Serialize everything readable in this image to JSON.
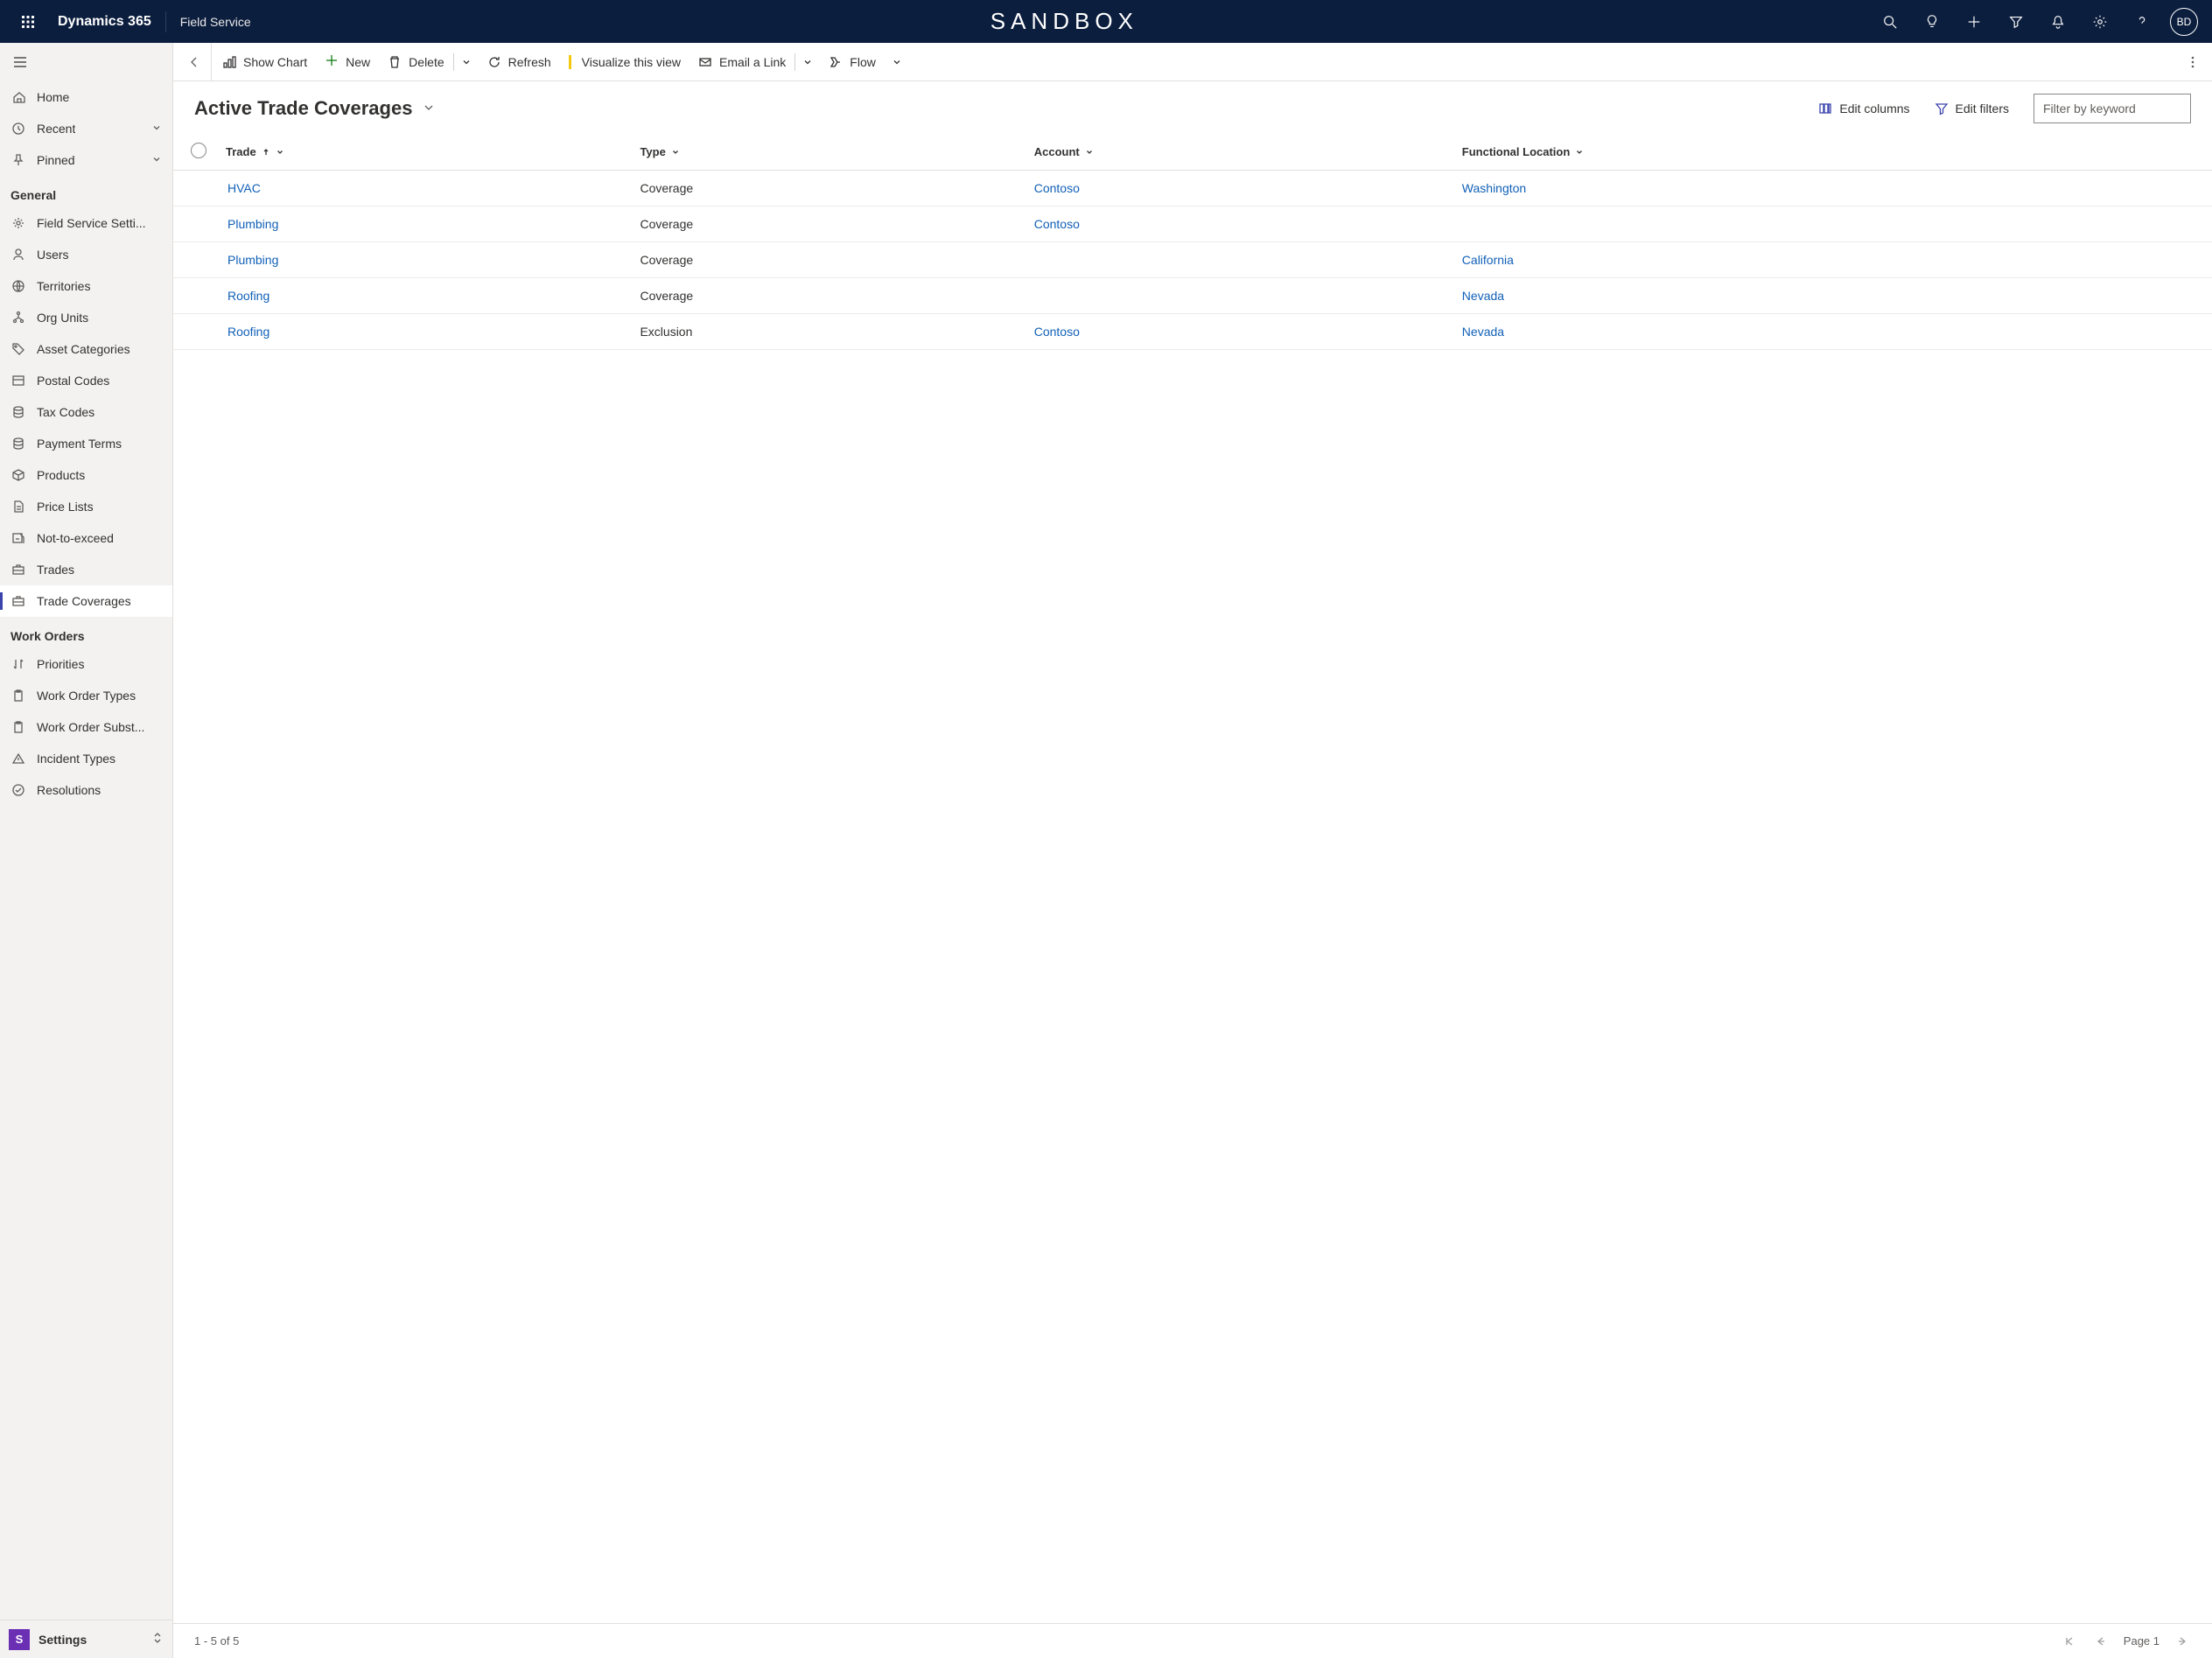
{
  "topbar": {
    "brand": "Dynamics 365",
    "module": "Field Service",
    "environment": "SANDBOX",
    "avatar_initials": "BD"
  },
  "sidebar": {
    "top": [
      {
        "label": "Home",
        "icon": "home"
      },
      {
        "label": "Recent",
        "icon": "clock",
        "expandable": true
      },
      {
        "label": "Pinned",
        "icon": "pin",
        "expandable": true
      }
    ],
    "sections": [
      {
        "header": "General",
        "items": [
          {
            "label": "Field Service Setti...",
            "icon": "gear"
          },
          {
            "label": "Users",
            "icon": "person"
          },
          {
            "label": "Territories",
            "icon": "globe"
          },
          {
            "label": "Org Units",
            "icon": "org"
          },
          {
            "label": "Asset Categories",
            "icon": "tag"
          },
          {
            "label": "Postal Codes",
            "icon": "box"
          },
          {
            "label": "Tax Codes",
            "icon": "db"
          },
          {
            "label": "Payment Terms",
            "icon": "db"
          },
          {
            "label": "Products",
            "icon": "cube"
          },
          {
            "label": "Price Lists",
            "icon": "doc"
          },
          {
            "label": "Not-to-exceed",
            "icon": "nte"
          },
          {
            "label": "Trades",
            "icon": "briefcase"
          },
          {
            "label": "Trade Coverages",
            "icon": "briefcase",
            "active": true
          }
        ]
      },
      {
        "header": "Work Orders",
        "items": [
          {
            "label": "Priorities",
            "icon": "sort"
          },
          {
            "label": "Work Order Types",
            "icon": "clip"
          },
          {
            "label": "Work Order Subst...",
            "icon": "clip"
          },
          {
            "label": "Incident Types",
            "icon": "warn"
          },
          {
            "label": "Resolutions",
            "icon": "check"
          }
        ]
      }
    ],
    "area": {
      "initial": "S",
      "label": "Settings"
    }
  },
  "commandbar": {
    "show_chart": "Show Chart",
    "new": "New",
    "delete": "Delete",
    "refresh": "Refresh",
    "visualize": "Visualize this view",
    "email": "Email a Link",
    "flow": "Flow"
  },
  "view": {
    "title": "Active Trade Coverages",
    "edit_columns": "Edit columns",
    "edit_filters": "Edit filters",
    "filter_placeholder": "Filter by keyword"
  },
  "grid": {
    "columns": [
      {
        "label": "Trade",
        "sort": "asc"
      },
      {
        "label": "Type"
      },
      {
        "label": "Account"
      },
      {
        "label": "Functional Location"
      }
    ],
    "rows": [
      {
        "trade": "HVAC",
        "type": "Coverage",
        "account": "Contoso",
        "location": "Washington"
      },
      {
        "trade": "Plumbing",
        "type": "Coverage",
        "account": "Contoso",
        "location": ""
      },
      {
        "trade": "Plumbing",
        "type": "Coverage",
        "account": "",
        "location": "California"
      },
      {
        "trade": "Roofing",
        "type": "Coverage",
        "account": "",
        "location": "Nevada"
      },
      {
        "trade": "Roofing",
        "type": "Exclusion",
        "account": "Contoso",
        "location": "Nevada"
      }
    ]
  },
  "statusbar": {
    "range": "1 - 5 of 5",
    "page": "Page 1"
  }
}
